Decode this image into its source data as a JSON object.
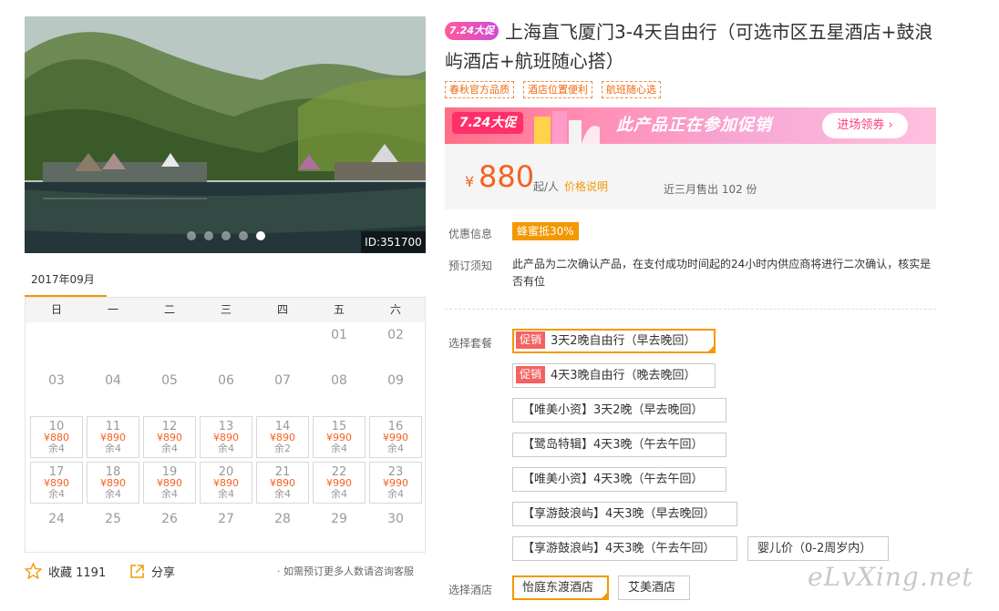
{
  "gallery": {
    "image_id": "ID:351700",
    "slide_count": 5,
    "active_slide": 5
  },
  "calendar": {
    "month_label": "2017年09月",
    "weekdays": [
      "日",
      "一",
      "二",
      "三",
      "四",
      "五",
      "六"
    ],
    "row1": [
      "01",
      "02"
    ],
    "row2": [
      "03",
      "04",
      "05",
      "06",
      "07",
      "08",
      "09"
    ],
    "row3": [
      {
        "day": "10",
        "price": "¥880",
        "stock": "余4"
      },
      {
        "day": "11",
        "price": "¥890",
        "stock": "余4"
      },
      {
        "day": "12",
        "price": "¥890",
        "stock": "余4"
      },
      {
        "day": "13",
        "price": "¥890",
        "stock": "余4"
      },
      {
        "day": "14",
        "price": "¥890",
        "stock": "余2"
      },
      {
        "day": "15",
        "price": "¥990",
        "stock": "余4"
      },
      {
        "day": "16",
        "price": "¥990",
        "stock": "余4"
      }
    ],
    "row4": [
      {
        "day": "17",
        "price": "¥890",
        "stock": "余4"
      },
      {
        "day": "18",
        "price": "¥890",
        "stock": "余4"
      },
      {
        "day": "19",
        "price": "¥890",
        "stock": "余4"
      },
      {
        "day": "20",
        "price": "¥890",
        "stock": "余4"
      },
      {
        "day": "21",
        "price": "¥890",
        "stock": "余4"
      },
      {
        "day": "22",
        "price": "¥990",
        "stock": "余4"
      },
      {
        "day": "23",
        "price": "¥990",
        "stock": "余4"
      }
    ],
    "row5": [
      "24",
      "25",
      "26",
      "27",
      "28",
      "29",
      "30"
    ]
  },
  "actions": {
    "favorite_label": "收藏 1191",
    "share_label": "分享",
    "consult_text": "· 如需预订更多人数请咨询客服"
  },
  "product": {
    "promo_tag": "7.24大促",
    "title": "上海直飞厦门3-4天自由行（可选市区五星酒店+鼓浪屿酒店+航班随心搭）",
    "badges": [
      "春秋官方品质",
      "酒店位置便利",
      "航班随心选"
    ]
  },
  "banner": {
    "logo": "7.24大促",
    "text": "此产品正在参加促销",
    "button": "进场领券 ›"
  },
  "price": {
    "symbol": "¥",
    "amount": "880",
    "unit": "起/人",
    "note_link": "价格说明",
    "sold": "近三月售出 102 份",
    "accent_color": "#f76120"
  },
  "info": {
    "discount_label": "优惠信息",
    "discount_value": "蜂蜜抵30%",
    "notice_label": "预订须知",
    "notice_text": "此产品为二次确认产品，在支付成功时间起的24小时内供应商将进行二次确认，核实是否有位"
  },
  "packages": {
    "label": "选择套餐",
    "promo_tag": "促销",
    "options": [
      {
        "text": "3天2晚自由行（早去晚回）"
      },
      {
        "text": "4天3晚自由行（晚去晚回）"
      },
      {
        "text": "【唯美小资】3天2晚（早去晚回）"
      },
      {
        "text": "【鹭岛特辑】4天3晚（午去午回）"
      },
      {
        "text": "【唯美小资】4天3晚（午去午回）"
      },
      {
        "text": "【享游鼓浪屿】4天3晚（早去晚回）"
      },
      {
        "text": "【享游鼓浪屿】4天3晚（午去午回）"
      },
      {
        "text": "婴儿价（0-2周岁内）"
      }
    ],
    "selected_index": 0
  },
  "hotels": {
    "label": "选择酒店",
    "options": [
      "怡庭东渡酒店",
      "艾美酒店"
    ],
    "selected_index": 0
  },
  "watermark": "eLvXing.net"
}
